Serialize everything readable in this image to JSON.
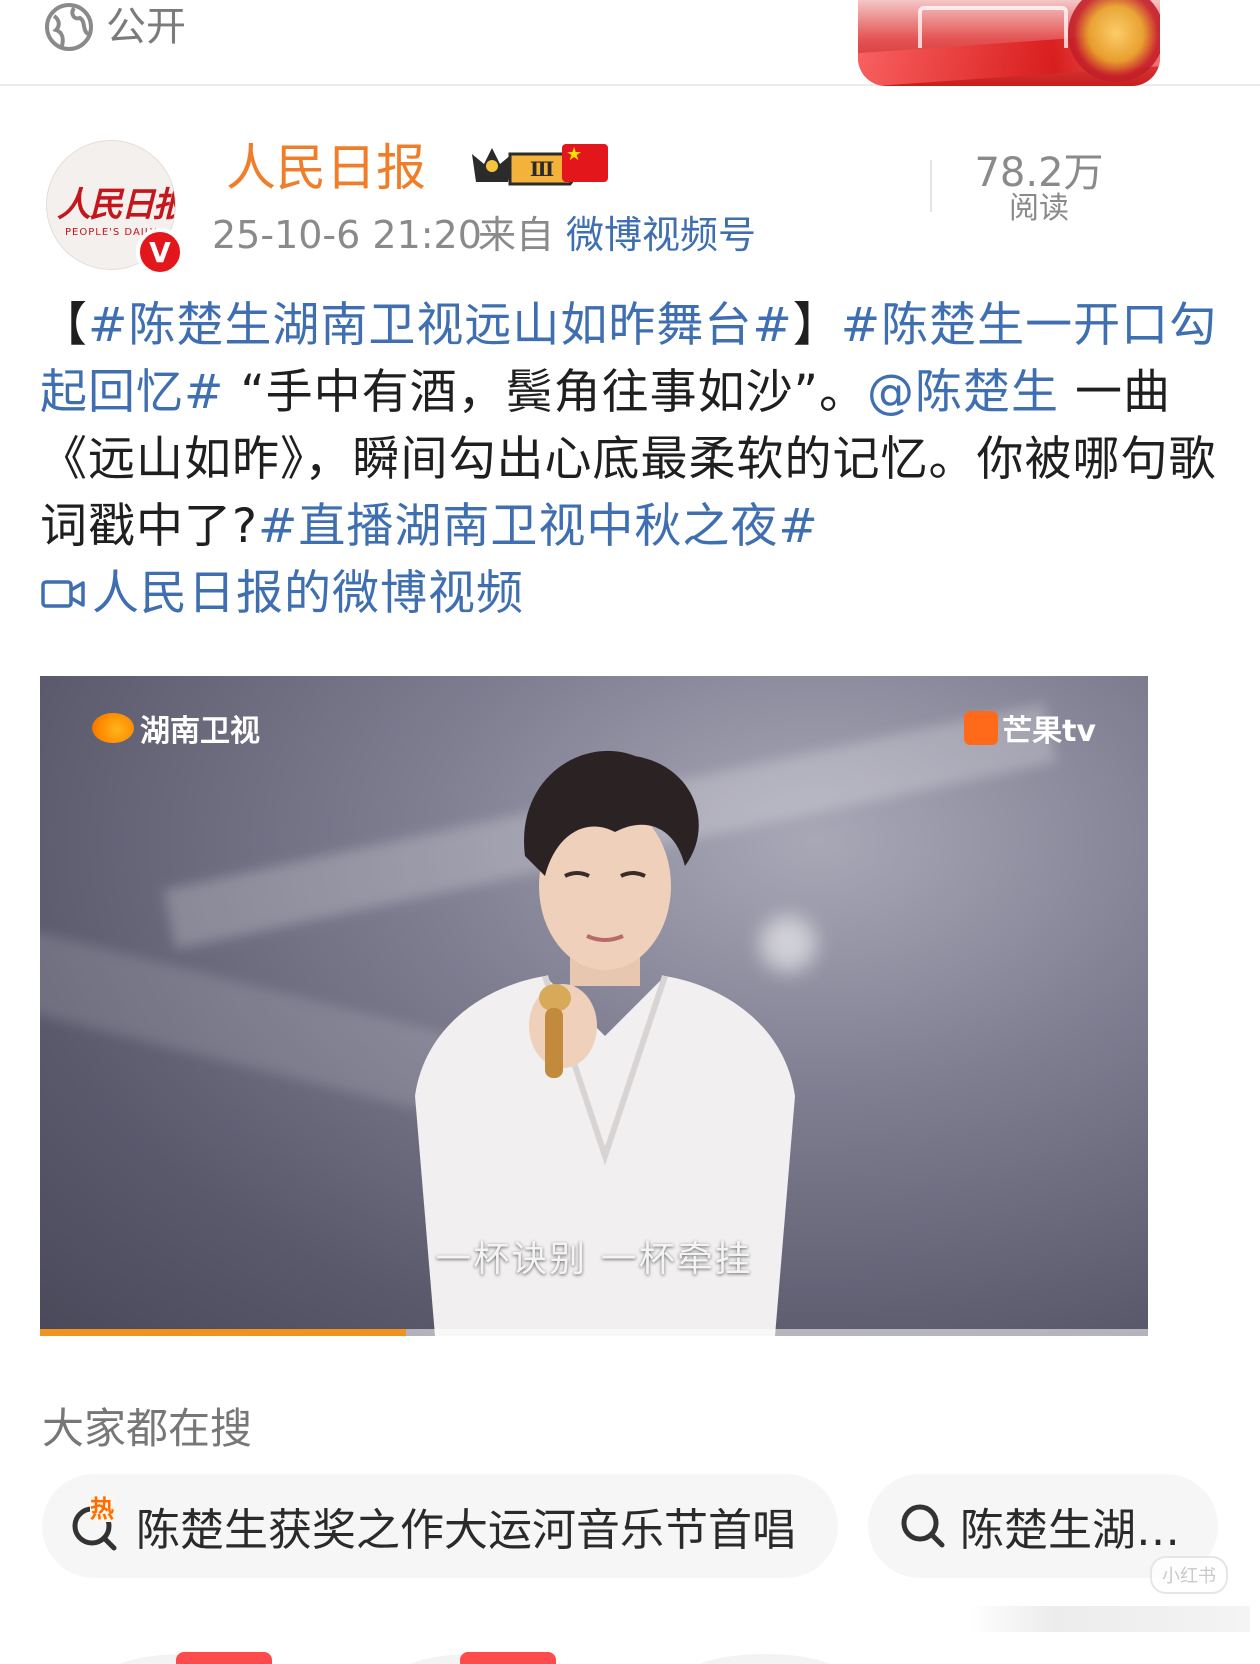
{
  "top": {
    "visibility_label": "公开"
  },
  "author": {
    "avatar_logo": "人民日报",
    "avatar_sub": "PEOPLE'S DAILY",
    "verified_mark": "V",
    "name": "人民日报",
    "badge_level": "Ⅲ",
    "time": "25-10-6 21:20",
    "from_label": "来自",
    "source": "微博视频号",
    "read_count": "78.2万",
    "read_label": "阅读"
  },
  "post": {
    "bracket_open": "【",
    "topic_1": "#陈楚生湖南卫视远山如昨舞台#",
    "bracket_close": "】",
    "topic_2": "#陈楚生一开口勾起回忆#",
    "quote": " “手中有酒，鬓角往事如沙”。",
    "mention": "@陈楚生",
    "text_1": " 一曲《远山如昨》，瞬间勾出心底最柔软的记忆。你被哪句歌词戳中了?",
    "topic_3": "#直播湖南卫视中秋之夜#",
    "video_link": "人民日报的微博视频"
  },
  "video": {
    "watermark_left": "湖南卫视",
    "watermark_right": "芒果tv",
    "subtitle": "一杯诀别 一杯牵挂",
    "progress": 0.33
  },
  "search": {
    "title": "大家都在搜",
    "hot_mark": "热",
    "chips": [
      "陈楚生获奖之作大运河音乐节首唱",
      "陈楚生湖…"
    ],
    "app_watermark": "小红书"
  },
  "colors": {
    "link": "#3f6fb1",
    "name": "#f07d2a",
    "progress": "#f0931e"
  }
}
